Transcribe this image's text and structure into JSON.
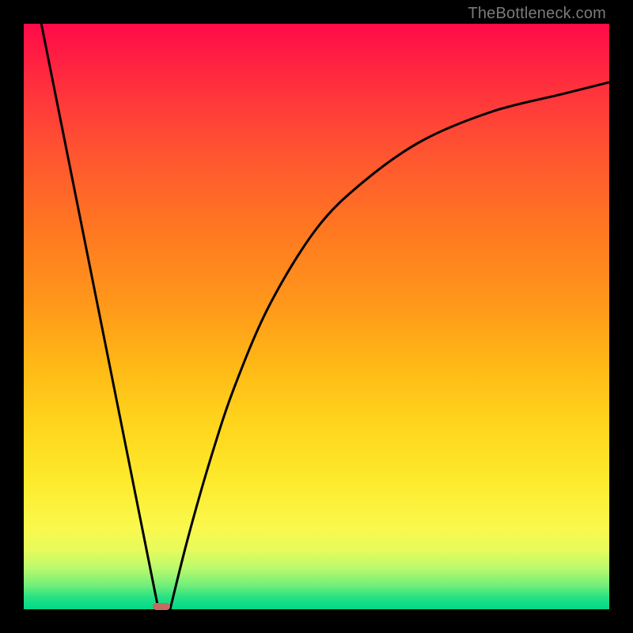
{
  "watermark": "TheBottleneck.com",
  "colors": {
    "frame": "#000000",
    "curve_stroke": "#000000",
    "marker": "#c46b5e",
    "watermark": "#7a7a7a"
  },
  "chart_data": {
    "type": "line",
    "title": "",
    "xlabel": "",
    "ylabel": "",
    "xlim": [
      0,
      100
    ],
    "ylim": [
      0,
      100
    ],
    "grid": false,
    "legend": false,
    "series": [
      {
        "name": "left-branch",
        "description": "Steep descending line from top-left toward the dip",
        "x": [
          3,
          23
        ],
        "y": [
          100,
          0
        ]
      },
      {
        "name": "right-branch",
        "description": "Concave curve rising from the dip toward upper-right, flattening",
        "x": [
          25,
          28,
          32,
          36,
          42,
          50,
          58,
          68,
          80,
          92,
          100
        ],
        "y": [
          0,
          12,
          26,
          38,
          52,
          65,
          73,
          80,
          85,
          88,
          90
        ]
      }
    ],
    "marker": {
      "description": "Small rounded marker at the dip near the bottom",
      "x": 23.5,
      "y": 0.5,
      "width_pct": 3,
      "height_pct": 1.2
    }
  }
}
